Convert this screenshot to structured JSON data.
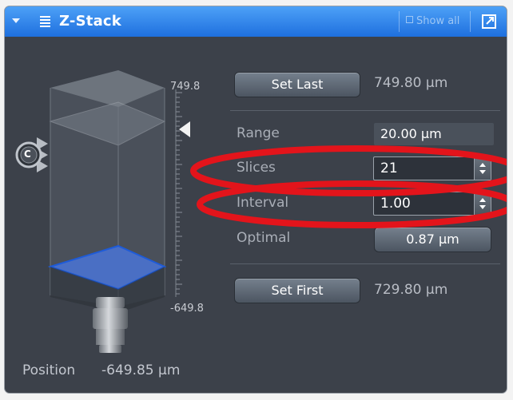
{
  "header": {
    "title": "Z-Stack",
    "show_all_label": "Show all"
  },
  "scale": {
    "top_label": "749.8",
    "bottom_label": "-649.8"
  },
  "handle": {
    "label": "C"
  },
  "position": {
    "label": "Position",
    "value": "-649.85 µm"
  },
  "controls": {
    "set_last_label": "Set Last",
    "last_value": "749.80 µm",
    "range_label": "Range",
    "range_value": "20.00 µm",
    "slices_label": "Slices",
    "slices_value": "21",
    "interval_label": "Interval",
    "interval_value": "1.00",
    "optimal_label": "Optimal",
    "optimal_value": "0.87 µm",
    "set_first_label": "Set First",
    "first_value": "729.80 µm"
  },
  "colors": {
    "panel_bg": "#3c414a",
    "header_blue": "#1e6fde",
    "highlight_ellipse": "#e3141b",
    "focus_plane": "#4a6fc4"
  }
}
